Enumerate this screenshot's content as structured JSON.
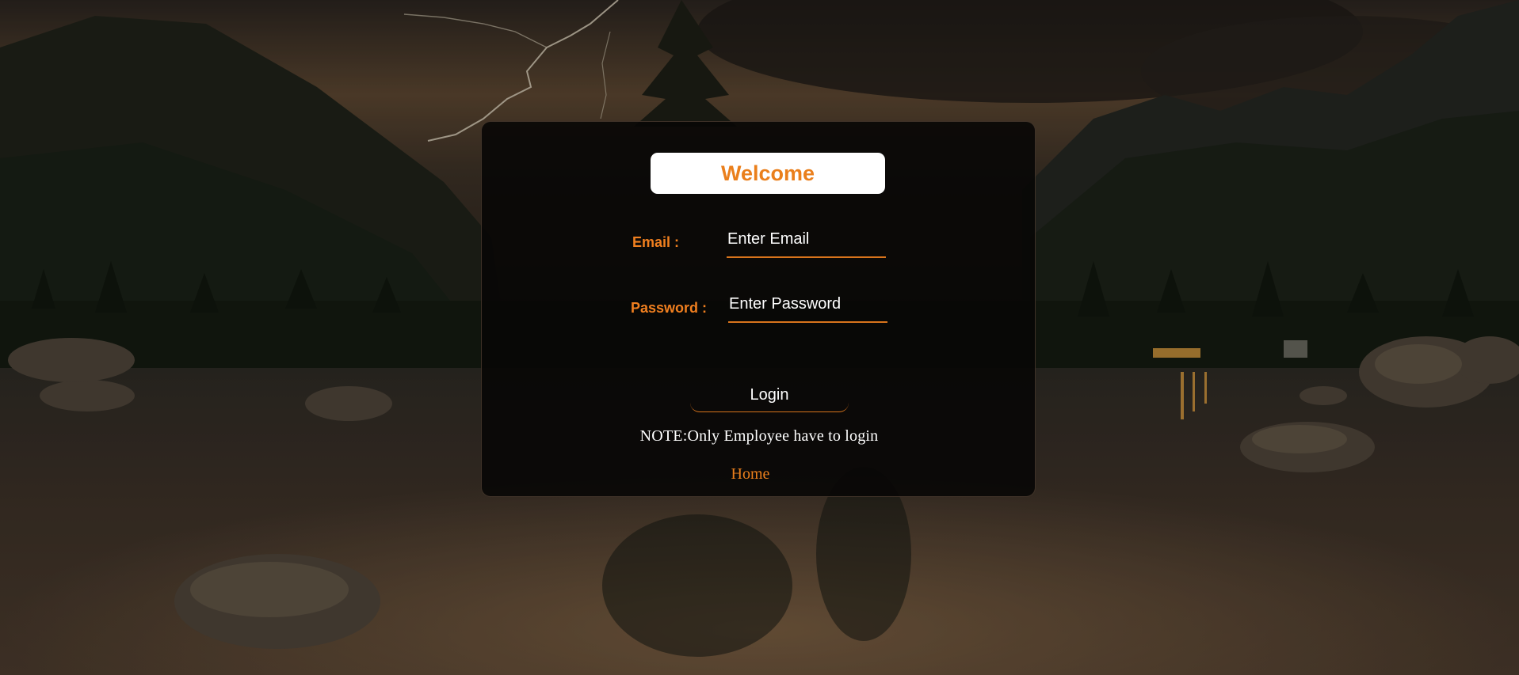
{
  "background": {
    "description_icon": "mountain-lake-storm-image"
  },
  "colors": {
    "accent": "#ea7f1c",
    "card_bg": "#080706",
    "text": "#ffffff"
  },
  "login": {
    "title": "Welcome",
    "email_label": "Email :",
    "email_placeholder": "Enter Email",
    "password_label": "Password :",
    "password_placeholder": "Enter Password",
    "button_label": "Login",
    "note": "NOTE:Only Employee have to login",
    "home_link": "Home"
  }
}
